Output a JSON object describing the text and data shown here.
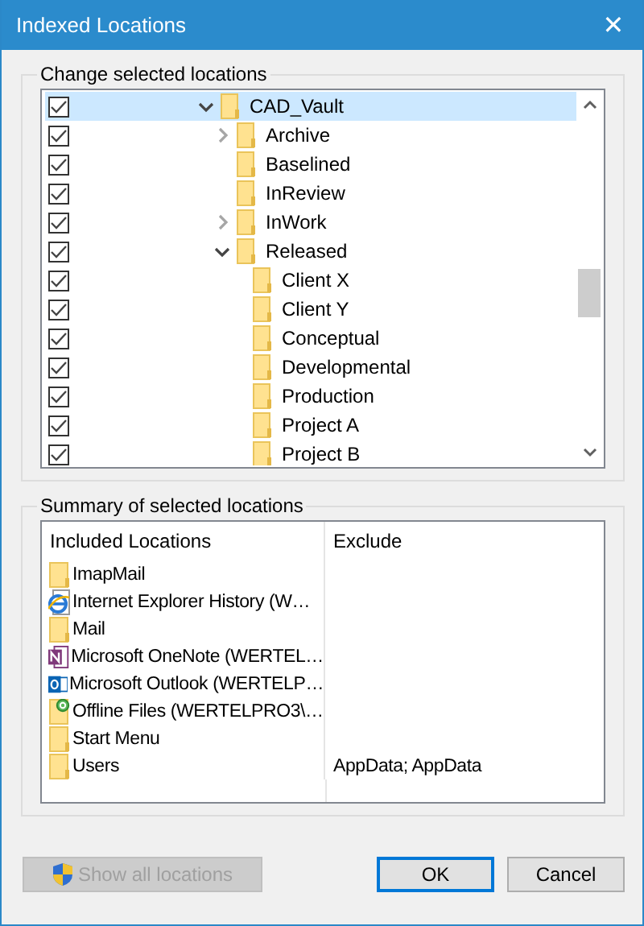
{
  "window": {
    "title": "Indexed Locations",
    "close": "✕"
  },
  "change_group": {
    "title": "Change selected locations",
    "tree": [
      {
        "label": "CAD_Vault",
        "checked": true,
        "selected": true,
        "expandable": true,
        "expanded": true,
        "children": [
          {
            "label": "Archive",
            "checked": true,
            "selected": false,
            "expandable": true,
            "expanded": false
          },
          {
            "label": "Baselined",
            "checked": true,
            "selected": false,
            "expandable": false
          },
          {
            "label": "InReview",
            "checked": true,
            "selected": false,
            "expandable": false
          },
          {
            "label": "InWork",
            "checked": true,
            "selected": false,
            "expandable": true,
            "expanded": false
          },
          {
            "label": "Released",
            "checked": true,
            "selected": false,
            "expandable": true,
            "expanded": true,
            "children": [
              {
                "label": "Client X",
                "checked": true,
                "selected": false,
                "expandable": false
              },
              {
                "label": "Client Y",
                "checked": true,
                "selected": false,
                "expandable": false
              },
              {
                "label": "Conceptual",
                "checked": true,
                "selected": false,
                "expandable": false
              },
              {
                "label": "Developmental",
                "checked": true,
                "selected": false,
                "expandable": false
              },
              {
                "label": "Production",
                "checked": true,
                "selected": false,
                "expandable": false
              },
              {
                "label": "Project A",
                "checked": true,
                "selected": false,
                "expandable": false
              },
              {
                "label": "Project B",
                "checked": true,
                "selected": false,
                "expandable": false
              }
            ]
          }
        ]
      }
    ]
  },
  "summary_group": {
    "title": "Summary of selected locations",
    "columns": [
      "Included Locations",
      "Exclude"
    ],
    "rows": [
      {
        "kind": "folder",
        "location": "ImapMail"
      },
      {
        "kind": "ie",
        "location": "Internet Explorer History (W…"
      },
      {
        "kind": "folder",
        "location": "Mail"
      },
      {
        "kind": "onenote",
        "location": "Microsoft OneNote (WERTEL…"
      },
      {
        "kind": "outlook",
        "location": "Microsoft Outlook (WERTELP…"
      },
      {
        "kind": "offline",
        "location": "Offline Files (WERTELPRO3\\…"
      },
      {
        "kind": "folder",
        "location": "Start Menu"
      },
      {
        "kind": "folder",
        "location": "Users",
        "exclude": "AppData; AppData"
      }
    ]
  },
  "buttons": [
    {
      "label": "Show all locations",
      "disabled": true,
      "default": false,
      "shield": true
    },
    {
      "label": "OK",
      "disabled": false,
      "default": true,
      "shield": false
    },
    {
      "label": "Cancel",
      "disabled": false,
      "default": false,
      "shield": false
    }
  ]
}
